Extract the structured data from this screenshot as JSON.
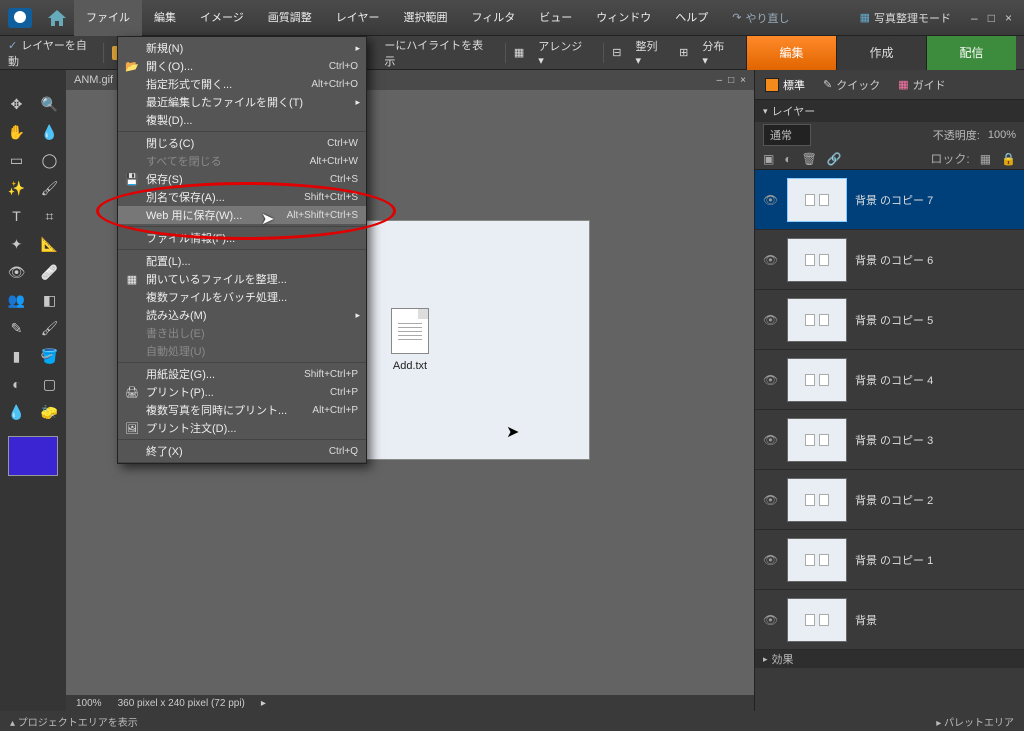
{
  "menubar": {
    "items": [
      "ファイル",
      "編集",
      "イメージ",
      "画質調整",
      "レイヤー",
      "選択範囲",
      "フィルタ",
      "ビュー",
      "ウィンドウ",
      "ヘルプ"
    ],
    "redo": "やり直し",
    "photo_mode": "写真整理モード"
  },
  "toolbar2": {
    "auto_layer": "レイヤーを自動",
    "highlight": "ーにハイライトを表示",
    "arrange": "アレンジ",
    "align": "整列",
    "distribute": "分布"
  },
  "mode_tabs": {
    "edit": "編集",
    "create": "作成",
    "share": "配信"
  },
  "doc": {
    "tab": "ANM.gif",
    "file_label": "Add.txt",
    "zoom": "100%",
    "dims": "360 pixel x 240 pixel (72 ppi)"
  },
  "panels": {
    "tabs": {
      "standard": "標準",
      "quick": "クイック",
      "guide": "ガイド"
    },
    "layers_title": "レイヤー",
    "blend": "通常",
    "opacity_label": "不透明度:",
    "opacity_val": "100%",
    "lock_label": "ロック:",
    "layers": [
      {
        "name": "背景 のコピー 7"
      },
      {
        "name": "背景 のコピー 6"
      },
      {
        "name": "背景 のコピー 5"
      },
      {
        "name": "背景 のコピー 4"
      },
      {
        "name": "背景 のコピー 3"
      },
      {
        "name": "背景 のコピー 2"
      },
      {
        "name": "背景 のコピー 1"
      },
      {
        "name": "背景"
      }
    ],
    "effects": "効果"
  },
  "dropdown": {
    "groups": [
      [
        {
          "label": "新規(N)",
          "sub": true
        },
        {
          "label": "開く(O)...",
          "sc": "Ctrl+O",
          "icon": "📂"
        },
        {
          "label": "指定形式で開く...",
          "sc": "Alt+Ctrl+O"
        },
        {
          "label": "最近編集したファイルを開く(T)",
          "sub": true
        },
        {
          "label": "複製(D)..."
        }
      ],
      [
        {
          "label": "閉じる(C)",
          "sc": "Ctrl+W"
        },
        {
          "label": "すべてを閉じる",
          "sc": "Alt+Ctrl+W",
          "dis": true
        },
        {
          "label": "保存(S)",
          "sc": "Ctrl+S",
          "icon": "💾"
        },
        {
          "label": "別名で保存(A)...",
          "sc": "Shift+Ctrl+S"
        },
        {
          "label": "Web 用に保存(W)...",
          "sc": "Alt+Shift+Ctrl+S",
          "hov": true
        }
      ],
      [
        {
          "label": "ファイル情報(F)..."
        }
      ],
      [
        {
          "label": "配置(L)..."
        },
        {
          "label": "開いているファイルを整理...",
          "icon": "▦"
        },
        {
          "label": "複数ファイルをバッチ処理..."
        },
        {
          "label": "読み込み(M)",
          "sub": true
        },
        {
          "label": "書き出し(E)",
          "dis": true
        },
        {
          "label": "自動処理(U)",
          "dis": true
        }
      ],
      [
        {
          "label": "用紙設定(G)...",
          "sc": "Shift+Ctrl+P"
        },
        {
          "label": "プリント(P)...",
          "sc": "Ctrl+P",
          "icon": "🖨"
        },
        {
          "label": "複数写真を同時にプリント...",
          "sc": "Alt+Ctrl+P"
        },
        {
          "label": "プリント注文(D)...",
          "icon": "🖼"
        }
      ],
      [
        {
          "label": "終了(X)",
          "sc": "Ctrl+Q"
        }
      ]
    ]
  },
  "footer": {
    "left": "▴ プロジェクトエリアを表示",
    "right": "▸ パレットエリア"
  }
}
